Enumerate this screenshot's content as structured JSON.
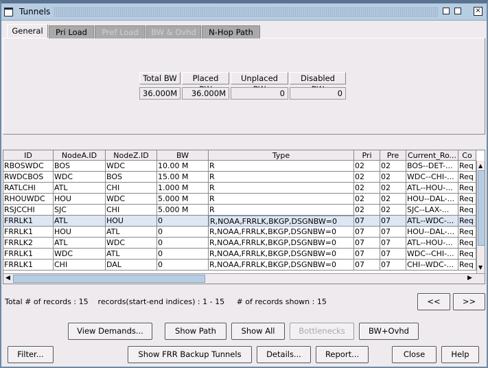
{
  "window": {
    "title": "Tunnels",
    "icons": [
      "window-icon",
      "restore-icon",
      "maximize-icon",
      "close-icon"
    ]
  },
  "tabs": [
    {
      "label": "General",
      "state": "active"
    },
    {
      "label": "Pri Load",
      "state": "enabled"
    },
    {
      "label": "Pref Load",
      "state": "disabled"
    },
    {
      "label": "BW & Ovhd",
      "state": "disabled"
    },
    {
      "label": "N-Hop Path",
      "state": "enabled"
    }
  ],
  "summary": {
    "headers": [
      "Total BW",
      "Placed BW",
      "Unplaced BW",
      "Disabled BW"
    ],
    "values": [
      "36.000M",
      "36.000M",
      "0",
      "0"
    ]
  },
  "table": {
    "columns": [
      "ID",
      "NodeA.ID",
      "NodeZ.ID",
      "BW",
      "Type",
      "Pri",
      "Pre",
      "Current_Ro...",
      "Co"
    ],
    "rows": [
      [
        "RBOSWDC",
        "BOS",
        "WDC",
        "10.00 M",
        "R",
        "02",
        "02",
        "BOS--DET-...",
        "Req"
      ],
      [
        "RWDCBOS",
        "WDC",
        "BOS",
        "15.00 M",
        "R",
        "02",
        "02",
        "WDC--CHI-...",
        "Req"
      ],
      [
        "RATLCHI",
        "ATL",
        "CHI",
        "1.000 M",
        "R",
        "02",
        "02",
        "ATL--HOU-...",
        "Req"
      ],
      [
        "RHOUWDC",
        "HOU",
        "WDC",
        "5.000 M",
        "R",
        "02",
        "02",
        "HOU--DAL-...",
        "Req"
      ],
      [
        "RSJCCHI",
        "SJC",
        "CHI",
        "5.000 M",
        "R",
        "02",
        "02",
        "SJC--LAX-...",
        "Req"
      ],
      [
        "FRRLK1",
        "ATL",
        "HOU",
        "0",
        "R,NOAA,FRRLK,BKGP,DSGNBW=0",
        "07",
        "07",
        "ATL--WDC-...",
        "Req"
      ],
      [
        "FRRLK1",
        "HOU",
        "ATL",
        "0",
        "R,NOAA,FRRLK,BKGP,DSGNBW=0",
        "07",
        "07",
        "HOU--DAL-...",
        "Req"
      ],
      [
        "FRRLK2",
        "ATL",
        "WDC",
        "0",
        "R,NOAA,FRRLK,BKGP,DSGNBW=0",
        "07",
        "07",
        "ATL--HOU-...",
        "Req"
      ],
      [
        "FRRLK1",
        "WDC",
        "ATL",
        "0",
        "R,NOAA,FRRLK,BKGP,DSGNBW=0",
        "07",
        "07",
        "WDC--CHI-...",
        "Req"
      ],
      [
        "FRRLK1",
        "CHI",
        "DAL",
        "0",
        "R,NOAA,FRRLK,BKGP,DSGNBW=0",
        "07",
        "07",
        "CHI--WDC-...",
        "Req"
      ]
    ],
    "selected_row": 5
  },
  "status": {
    "text": "Total # of records : 15    records(start-end indices) : 1 - 15     # of records shown : 15"
  },
  "paging": {
    "prev": "<<",
    "next": ">>"
  },
  "buttons_row1": [
    {
      "label": "View Demands...",
      "enabled": true
    },
    {
      "label": "Show Path",
      "enabled": true
    },
    {
      "label": "Show All",
      "enabled": true
    },
    {
      "label": "Bottlenecks",
      "enabled": false
    },
    {
      "label": "BW+Ovhd",
      "enabled": true
    }
  ],
  "buttons_row2": [
    {
      "label": "Filter..."
    },
    {
      "label": "Show FRR Backup Tunnels"
    },
    {
      "label": "Details..."
    },
    {
      "label": "Report..."
    },
    {
      "label": "Close"
    },
    {
      "label": "Help"
    }
  ]
}
